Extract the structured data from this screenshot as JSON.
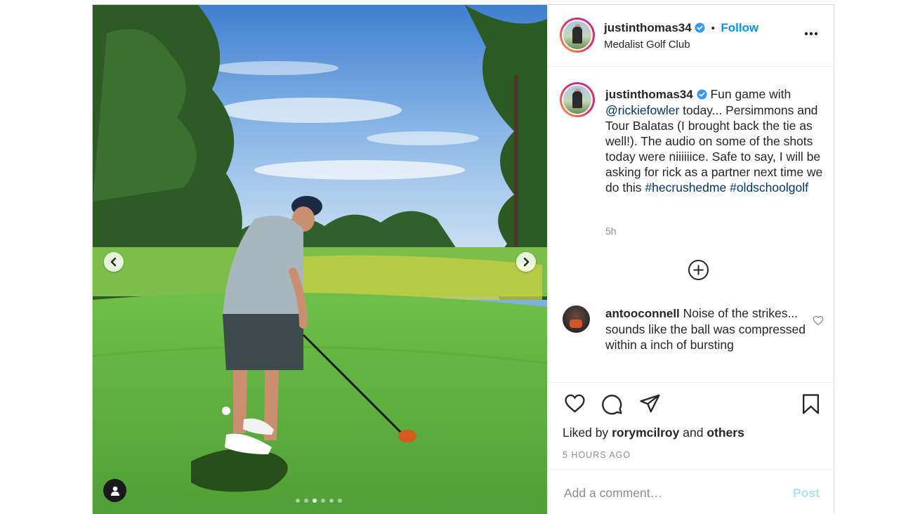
{
  "post": {
    "username": "justinthomas34",
    "separator": "•",
    "follow_label": "Follow",
    "location": "Medalist Golf Club",
    "verified_icon": "verified-badge-icon",
    "more_icon": "more-options-icon"
  },
  "caption": {
    "username": "justinthomas34",
    "text_1": "Fun game with",
    "mention": "@rickiefowler",
    "text_2": " today... Persimmons and Tour Balatas (I brought back the tie as well!). The audio on some of the shots today were niiiiiice. Safe to say, I will be asking for rick as a partner next time we do this ",
    "hashtag_1": "#hecrushedme",
    "hashtag_2": "#oldschoolgolf",
    "time": "5h"
  },
  "comment": {
    "username": "antooconnell",
    "text": " Noise of the strikes... sounds like the ball was compressed within a inch of bursting"
  },
  "actions": {
    "liked_prefix": "Liked by",
    "liked_user": "rorymcilroy",
    "liked_and": "and",
    "liked_others": "others",
    "time_ago": "5 HOURS AGO",
    "icons": [
      "heart-icon",
      "comment-icon",
      "share-icon",
      "bookmark-icon"
    ]
  },
  "composer": {
    "placeholder": "Add a comment…",
    "post_label": "Post"
  },
  "carousel": {
    "count": 6,
    "active_index": 2
  },
  "colors": {
    "accent": "#0095f6",
    "link": "#00376b",
    "muted": "#8e8e8e",
    "post_disabled": "#b2dffc"
  }
}
